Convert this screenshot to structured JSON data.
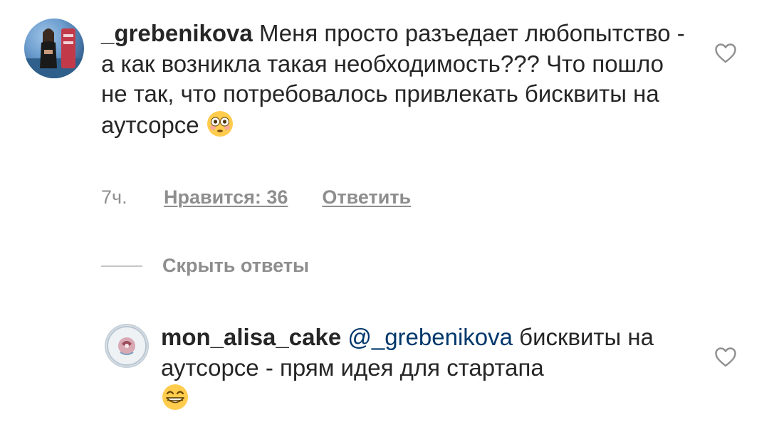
{
  "comments": [
    {
      "username": "_grebenikova",
      "text": "Меня просто разъедает любопытство - а как возникла такая необходимость??? Что пошло не так, что потребовалось привлекать бисквиты на аутсорсе",
      "emoji": "flushed-face",
      "time": "7ч.",
      "likes_label": "Нравится: 36",
      "reply_label": "Ответить",
      "hide_replies_label": "Скрыть ответы"
    },
    {
      "username": "mon_alisa_cake",
      "mention": "@_grebenikova",
      "text": "бисквиты на аутсорсе - прям идея для стартапа",
      "emoji": "grinning-face"
    }
  ],
  "icons": {
    "like": "heart-outline-icon"
  },
  "colors": {
    "text": "#262626",
    "secondary": "#8e8e8e",
    "mention": "#00376b",
    "divider": "#c7c7c7"
  }
}
